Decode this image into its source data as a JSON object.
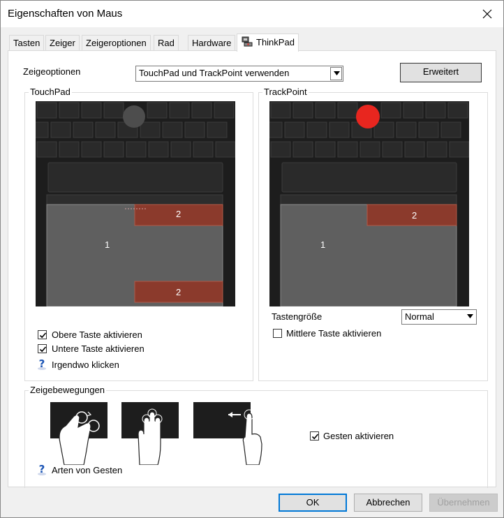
{
  "window": {
    "title": "Eigenschaften von Maus"
  },
  "tabs": [
    {
      "label": "Tasten"
    },
    {
      "label": "Zeiger"
    },
    {
      "label": "Zeigeroptionen"
    },
    {
      "label": "Rad"
    },
    {
      "label": "Hardware"
    },
    {
      "label": "ThinkPad",
      "active": true
    }
  ],
  "zeigeoptionen": {
    "label": "Zeigeoptionen",
    "selected": "TouchPad und TrackPoint verwenden",
    "advanced_button": "Erweitert"
  },
  "touchpad": {
    "group_title": "TouchPad",
    "zone_main": "1",
    "zone_top": "2",
    "zone_bottom": "2",
    "top_button_checkbox": {
      "label": "Obere Taste aktivieren",
      "checked": true
    },
    "bottom_button_checkbox": {
      "label": "Untere Taste aktivieren",
      "checked": true
    },
    "help_link": "Irgendwo klicken"
  },
  "trackpoint": {
    "group_title": "TrackPoint",
    "zone_main": "1",
    "zone_top": "2",
    "button_size_label": "Tastengröße",
    "button_size_value": "Normal",
    "middle_button_checkbox": {
      "label": "Mittlere Taste aktivieren",
      "checked": false
    }
  },
  "gestures": {
    "group_title": "Zeigebewegungen",
    "enable_checkbox": {
      "label": "Gesten aktivieren",
      "checked": true
    },
    "help_link": "Arten von Gesten",
    "icons": [
      "rotate-gesture-icon",
      "three-finger-gesture-icon",
      "swipe-left-gesture-icon"
    ]
  },
  "footer": {
    "ok": "OK",
    "cancel": "Abbrechen",
    "apply": "Übernehmen"
  },
  "colors": {
    "zone_highlight": "#8b3a2c",
    "trackpoint_active": "#e8261f",
    "trackpoint_inactive": "#555555",
    "focus_blue": "#0078d7"
  }
}
